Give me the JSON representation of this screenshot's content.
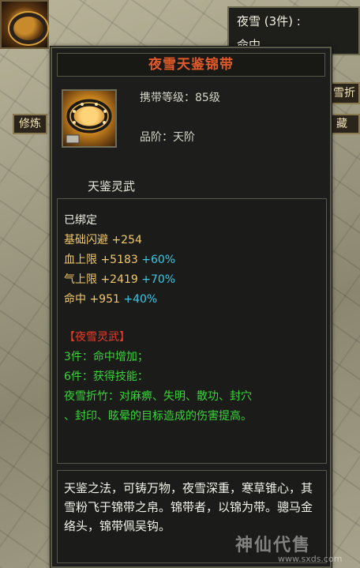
{
  "background": {
    "top_panel": {
      "line1": "夜雪 (3件) :",
      "line2": "命中"
    },
    "tab_left": "修炼",
    "tab_right": "藏",
    "right_button": "雪折"
  },
  "tooltip": {
    "title": "夜雪天鉴锦带",
    "carry_level": "携带等级：85级",
    "grade": "品阶：天阶",
    "set_name": "天鉴灵武",
    "bound": "已绑定",
    "stats": [
      {
        "name": "基础闪避",
        "value": "+254",
        "bonus": ""
      },
      {
        "name": "血上限",
        "value": "+5183",
        "bonus": "+60%"
      },
      {
        "name": "气上限",
        "value": "+2419",
        "bonus": "+70%"
      },
      {
        "name": "命中",
        "value": "+951",
        "bonus": "+40%"
      }
    ],
    "set_header": "【夜雪灵武】",
    "set_effects": [
      "3件：命中增加；",
      "6件：获得技能：",
      "夜雪折竹：对麻痹、失明、散功、封穴",
      "、封印、眩晕的目标造成的伤害提高。"
    ],
    "description": "天鉴之法，可铸万物，夜雪深重，寒草锥心，其雪粉飞于锦带之帛。锦带者，以锦为带。骢马金络头，锦带佩吴钩。"
  },
  "watermark": {
    "text": "神仙代售",
    "url": "www.sxds.com"
  },
  "colors": {
    "title": "#e25a2a",
    "stat_name": "#f3c86a",
    "bonus": "#38c8e8",
    "set_header": "#ee3a2a",
    "set_effect": "#3ad23a"
  }
}
